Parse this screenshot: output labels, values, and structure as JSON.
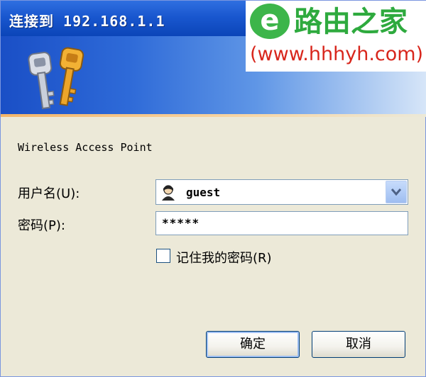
{
  "window": {
    "title": "连接到 192.168.1.1"
  },
  "watermark": {
    "logo_letter": "e",
    "brand": "路由之家",
    "url": "(www.hhhyh.com)"
  },
  "dialog": {
    "description": "Wireless Access Point",
    "username_label": "用户名(U):",
    "password_label": "密码(P):",
    "username_value": "guest",
    "password_mask": "*****",
    "remember_label": "记住我的密码(R)",
    "remember_checked": false,
    "ok_label": "确定",
    "cancel_label": "取消"
  },
  "icons": {
    "banner": "keys-icon",
    "user": "user-avatar-icon",
    "dropdown": "chevron-down-icon"
  }
}
